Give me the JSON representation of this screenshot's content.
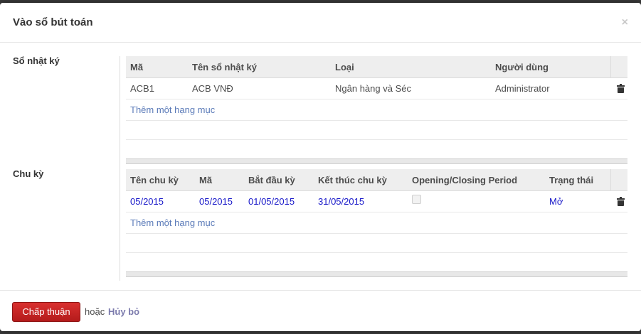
{
  "dialog": {
    "title": "Vào sổ bút toán",
    "close_glyph": "×"
  },
  "journal": {
    "label": "Sổ nhật ký",
    "columns": [
      "Mã",
      "Tên sổ nhật ký",
      "Loại",
      "Người dùng"
    ],
    "rows": [
      {
        "code": "ACB1",
        "name": "ACB VNĐ",
        "type": "Ngân hàng và Séc",
        "user": "Administrator"
      }
    ],
    "add_item": "Thêm một hạng mục"
  },
  "period": {
    "label": "Chu kỳ",
    "columns": [
      "Tên chu kỳ",
      "Mã",
      "Bắt đầu kỳ",
      "Kết thúc chu kỳ",
      "Opening/Closing Period",
      "Trạng thái"
    ],
    "rows": [
      {
        "name": "05/2015",
        "code": "05/2015",
        "start": "01/05/2015",
        "end": "31/05/2015",
        "opening_closing": false,
        "status": "Mở"
      }
    ],
    "add_item": "Thêm một hạng mục"
  },
  "footer": {
    "approve_label": "Chấp thuận",
    "or_text": "hoặc",
    "cancel_label": "Hủy bỏ"
  },
  "colors": {
    "primary_button": "#c52323",
    "link_blue": "#1515c8",
    "add_item_link": "#5a7ab8",
    "cancel_link": "#7c7bad"
  }
}
